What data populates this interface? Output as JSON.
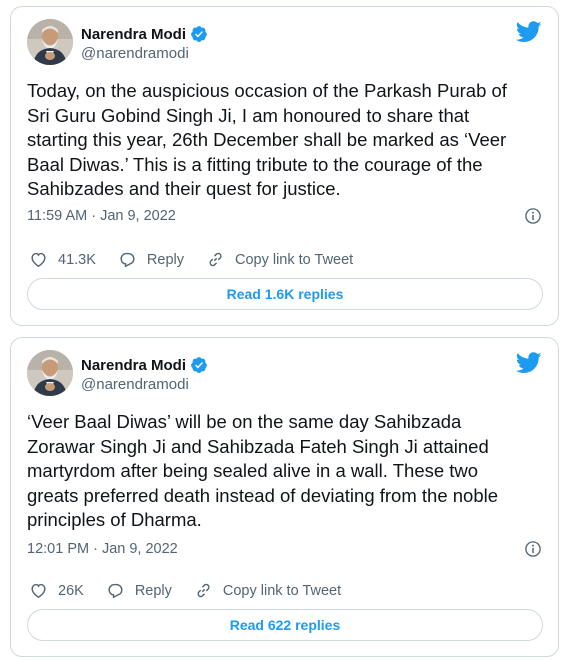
{
  "brand_color": "#1d9bf0",
  "tweets": [
    {
      "author_name": "Narendra Modi",
      "author_handle": "@narendramodi",
      "text": "Today, on the auspicious occasion of the Parkash Purab of\nSri Guru Gobind Singh Ji, I am honoured to share that\nstarting this year, 26th December shall be marked as ‘Veer\nBaal Diwas.’ This is a fitting tribute to the courage of the\nSahibzades and their quest for justice.",
      "timestamp": "11:59 AM · Jan 9, 2022",
      "likes": "41.3K",
      "reply_label": "Reply",
      "copy_label": "Copy link to Tweet",
      "replies_button": "Read 1.6K replies"
    },
    {
      "author_name": "Narendra Modi",
      "author_handle": "@narendramodi",
      "text": "‘Veer Baal Diwas’ will be on the same day Sahibzada\nZorawar Singh Ji and Sahibzada Fateh Singh Ji attained\nmartyrdom after being sealed alive in a wall. These two\ngreats preferred death instead of deviating from the noble\nprinciples of Dharma.",
      "timestamp": "12:01 PM · Jan 9, 2022",
      "likes": "26K",
      "reply_label": "Reply",
      "copy_label": "Copy link to Tweet",
      "replies_button": "Read 622 replies"
    }
  ]
}
